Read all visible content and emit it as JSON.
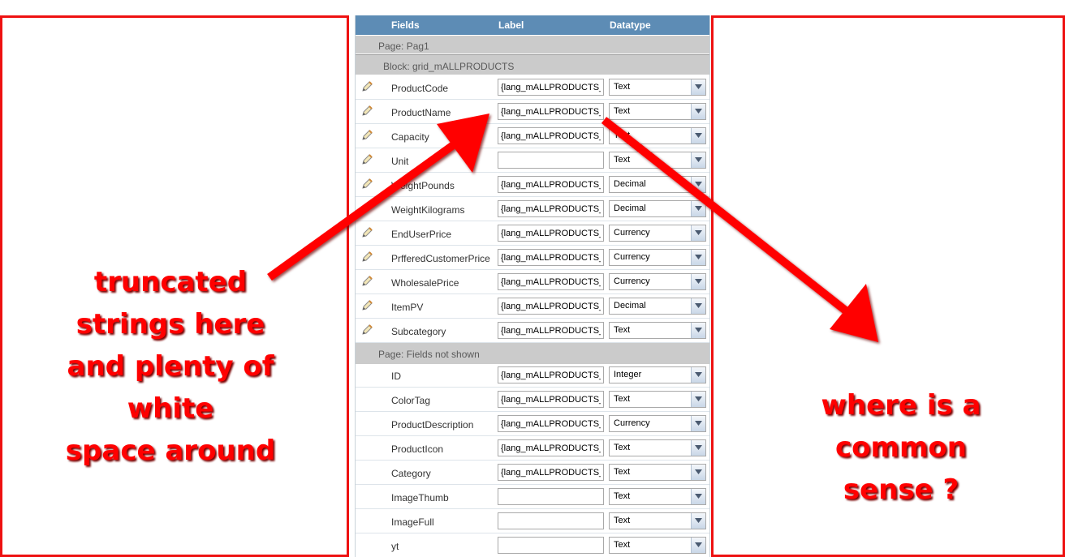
{
  "grid": {
    "headers": {
      "fields": "Fields",
      "label": "Label",
      "datatype": "Datatype"
    },
    "page1": "Page: Pag1",
    "block": "Block: grid_mALLPRODUCTS",
    "page2": "Page: Fields not shown",
    "rows1": [
      {
        "field": "ProductCode",
        "label": "{lang_mALLPRODUCTS_fl",
        "type": "Text"
      },
      {
        "field": "ProductName",
        "label": "{lang_mALLPRODUCTS_fl",
        "type": "Text"
      },
      {
        "field": "Capacity",
        "label": "{lang_mALLPRODUCTS_fl",
        "type": "Text"
      },
      {
        "field": "Unit",
        "label": "",
        "type": "Text"
      },
      {
        "field": "WeightPounds",
        "label": "{lang_mALLPRODUCTS_fl",
        "type": "Decimal"
      },
      {
        "field": "WeightKilograms",
        "label": "{lang_mALLPRODUCTS_fl",
        "type": "Decimal"
      },
      {
        "field": "EndUserPrice",
        "label": "{lang_mALLPRODUCTS_fl",
        "type": "Currency"
      },
      {
        "field": "PrfferedCustomerPrice",
        "label": "{lang_mALLPRODUCTS_fl",
        "type": "Currency"
      },
      {
        "field": "WholesalePrice",
        "label": "{lang_mALLPRODUCTS_fl",
        "type": "Currency"
      },
      {
        "field": "ItemPV",
        "label": "{lang_mALLPRODUCTS_fl",
        "type": "Decimal"
      },
      {
        "field": "Subcategory",
        "label": "{lang_mALLPRODUCTS_fl",
        "type": "Text"
      }
    ],
    "rows2": [
      {
        "field": "ID",
        "label": "{lang_mALLPRODUCTS_fl",
        "type": "Integer"
      },
      {
        "field": "ColorTag",
        "label": "{lang_mALLPRODUCTS_fl",
        "type": "Text"
      },
      {
        "field": "ProductDescription",
        "label": "{lang_mALLPRODUCTS_fl",
        "type": "Currency"
      },
      {
        "field": "ProductIcon",
        "label": "{lang_mALLPRODUCTS_fl",
        "type": "Text"
      },
      {
        "field": "Category",
        "label": "{lang_mALLPRODUCTS_fl",
        "type": "Text"
      },
      {
        "field": "ImageThumb",
        "label": "",
        "type": "Text"
      },
      {
        "field": "ImageFull",
        "label": "",
        "type": "Text"
      },
      {
        "field": "yt",
        "label": "",
        "type": "Text"
      }
    ]
  },
  "annotations": {
    "left": [
      "truncated",
      "strings here",
      "and plenty of",
      "white",
      "space around"
    ],
    "right": [
      "where is a",
      "common",
      "sense ?"
    ]
  },
  "colors": {
    "annotation_red": "#ff0000",
    "header_blue": "#5d8cb5",
    "section_gray": "#cbcbcb"
  }
}
